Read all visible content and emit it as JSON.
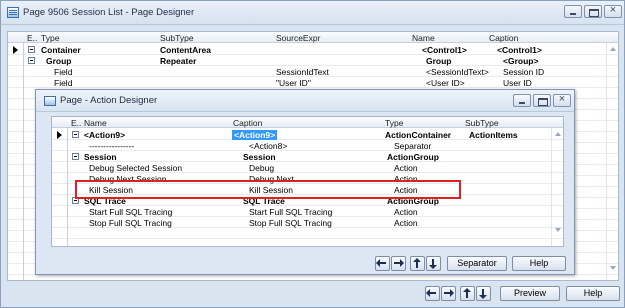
{
  "outer": {
    "title": "Page 9506 Session List - Page Designer",
    "columns": [
      "E..",
      "Type",
      "SubType",
      "SourceExpr",
      "Name",
      "Caption"
    ],
    "rows": [
      {
        "type": "Container",
        "subtype": "ContentArea",
        "source": "",
        "name": "<Control1>",
        "caption": "<Control1>",
        "bold": true,
        "selected": true,
        "expander": true
      },
      {
        "type": "Group",
        "subtype": "Repeater",
        "source": "",
        "name": "Group",
        "caption": "<Group>",
        "bold": true,
        "selected": false,
        "expander": true
      },
      {
        "type": "Field",
        "subtype": "",
        "source": "SessionIdText",
        "name": "<SessionIdText>",
        "caption": "Session ID",
        "bold": false,
        "selected": false,
        "expander": false
      },
      {
        "type": "Field",
        "subtype": "",
        "source": "\"User ID\"",
        "name": "<User ID>",
        "caption": "User ID",
        "bold": false,
        "selected": false,
        "expander": false
      }
    ],
    "buttons": {
      "preview": "Preview",
      "help": "Help"
    }
  },
  "inner": {
    "title": "Page - Action Designer",
    "columns": [
      "E..",
      "Name",
      "Caption",
      "Type",
      "SubType"
    ],
    "rows": [
      {
        "name": "<Action9>",
        "caption": "<Action9>",
        "type": "ActionContainer",
        "subtype": "ActionItems",
        "bold": true,
        "selected": true,
        "expander": true,
        "highlight": true
      },
      {
        "name": "----------------",
        "caption": "<Action8>",
        "type": "Separator",
        "subtype": "",
        "bold": false,
        "selected": false,
        "expander": false,
        "highlight": false
      },
      {
        "name": "Session",
        "caption": "Session",
        "type": "ActionGroup",
        "subtype": "",
        "bold": true,
        "selected": false,
        "expander": true,
        "highlight": false
      },
      {
        "name": "Debug Selected Session",
        "caption": "Debug",
        "type": "Action",
        "subtype": "",
        "bold": false,
        "selected": false,
        "expander": false,
        "highlight": false
      },
      {
        "name": "Debug Next Session",
        "caption": "Debug Next",
        "type": "Action",
        "subtype": "",
        "bold": false,
        "selected": false,
        "expander": false,
        "highlight": false
      },
      {
        "name": "Kill Session",
        "caption": "Kill Session",
        "type": "Action",
        "subtype": "",
        "bold": false,
        "selected": false,
        "expander": false,
        "highlight": false
      },
      {
        "name": "SQL Trace",
        "caption": "SQL Trace",
        "type": "ActionGroup",
        "subtype": "",
        "bold": true,
        "selected": false,
        "expander": true,
        "highlight": false
      },
      {
        "name": "Start Full SQL Tracing",
        "caption": "Start Full SQL Tracing",
        "type": "Action",
        "subtype": "",
        "bold": false,
        "selected": false,
        "expander": false,
        "highlight": false
      },
      {
        "name": "Stop Full SQL Tracing",
        "caption": "Stop Full SQL Tracing",
        "type": "Action",
        "subtype": "",
        "bold": false,
        "selected": false,
        "expander": false,
        "highlight": false
      }
    ],
    "buttons": {
      "separator": "Separator",
      "help": "Help"
    }
  },
  "colors": {
    "highlight_annotation": "#e02020",
    "selection": "#3399ff",
    "window_bg": "#d9e4f1"
  },
  "icons": [
    "window-app-icon",
    "minimize-icon",
    "maximize-icon",
    "close-icon",
    "left-arrow-icon",
    "right-arrow-icon",
    "up-arrow-icon",
    "down-arrow-icon",
    "row-selector-icon",
    "collapse-icon"
  ]
}
